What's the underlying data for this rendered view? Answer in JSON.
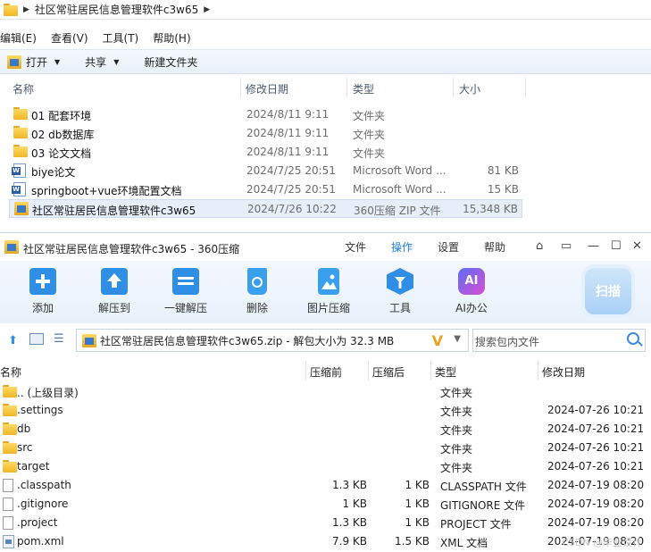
{
  "explorer": {
    "breadcrumb": "社区常驻居民信息管理软件c3w65",
    "menu": [
      "编辑(E)",
      "查看(V)",
      "工具(T)",
      "帮助(H)"
    ],
    "toolbar": {
      "open": "打开",
      "share": "共享",
      "new_folder": "新建文件夹"
    },
    "columns": {
      "name": "名称",
      "date": "修改日期",
      "type": "类型",
      "size": "大小"
    },
    "rows": [
      {
        "name": "01 配套环境",
        "date": "2024/8/11 9:11",
        "type": "文件夹",
        "size": "",
        "icon": "folder-icon"
      },
      {
        "name": "02 db数据库",
        "date": "2024/8/11 9:11",
        "type": "文件夹",
        "size": "",
        "icon": "folder-icon"
      },
      {
        "name": "03 论文文档",
        "date": "2024/8/11 9:11",
        "type": "文件夹",
        "size": "",
        "icon": "folder-icon"
      },
      {
        "name": "biye论文",
        "date": "2024/7/25 20:51",
        "type": "Microsoft Word ...",
        "size": "81 KB",
        "icon": "word-doc-icon"
      },
      {
        "name": "springboot+vue环境配置文档",
        "date": "2024/7/25 20:51",
        "type": "Microsoft Word ...",
        "size": "15 KB",
        "icon": "word-doc-icon"
      },
      {
        "name": "社区常驻居民信息管理软件c3w65",
        "date": "2024/7/26 10:22",
        "type": "360压缩 ZIP 文件",
        "size": "15,348 KB",
        "icon": "zip-icon"
      }
    ]
  },
  "zip": {
    "title": "社区常驻居民信息管理软件c3w65 - 360压缩",
    "tabs": [
      "文件",
      "操作",
      "设置",
      "帮助"
    ],
    "active_tab": "操作",
    "tools": [
      "添加",
      "解压到",
      "一键解压",
      "删除",
      "图片压缩",
      "工具",
      "AI办公"
    ],
    "scan_label": "扫描",
    "path": "社区常驻居民信息管理软件c3w65.zip - 解包大小为 32.3 MB",
    "search_placeholder": "搜索包内文件",
    "columns": {
      "name": "名称",
      "before": "压缩前",
      "after": "压缩后",
      "type": "类型",
      "date": "修改日期"
    },
    "rows": [
      {
        "name": ".. (上级目录)",
        "before": "",
        "after": "",
        "type": "文件夹",
        "date": "",
        "icon": "folder-icon"
      },
      {
        "name": ".settings",
        "before": "",
        "after": "",
        "type": "文件夹",
        "date": "2024-07-26 10:21",
        "icon": "folder-icon"
      },
      {
        "name": "db",
        "before": "",
        "after": "",
        "type": "文件夹",
        "date": "2024-07-26 10:21",
        "icon": "folder-icon"
      },
      {
        "name": "src",
        "before": "",
        "after": "",
        "type": "文件夹",
        "date": "2024-07-26 10:21",
        "icon": "folder-icon"
      },
      {
        "name": "target",
        "before": "",
        "after": "",
        "type": "文件夹",
        "date": "2024-07-26 10:21",
        "icon": "folder-icon"
      },
      {
        "name": ".classpath",
        "before": "1.3 KB",
        "after": "1 KB",
        "type": "CLASSPATH 文件",
        "date": "2024-07-19 08:20",
        "icon": "file-icon"
      },
      {
        "name": ".gitignore",
        "before": "1 KB",
        "after": "1 KB",
        "type": "GITIGNORE 文件",
        "date": "2024-07-19 08:20",
        "icon": "file-icon"
      },
      {
        "name": ".project",
        "before": "1.3 KB",
        "after": "1 KB",
        "type": "PROJECT 文件",
        "date": "2024-07-19 08:20",
        "icon": "file-icon"
      },
      {
        "name": "pom.xml",
        "before": "7.9 KB",
        "after": "1.5 KB",
        "type": "XML 文档",
        "date": "2024-07-19 08:20",
        "icon": "xml-file-icon"
      }
    ],
    "watermark": "CSDN @毕业设计"
  }
}
